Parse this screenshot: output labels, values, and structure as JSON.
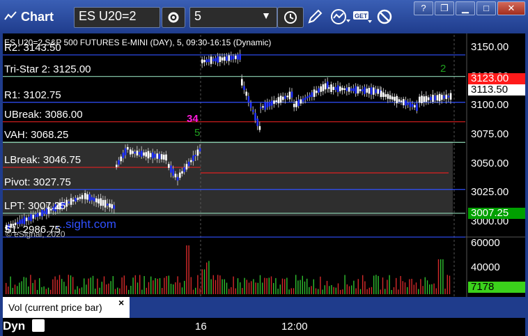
{
  "window": {
    "title": "Chart",
    "symbol": "ES U20=2",
    "interval": "5",
    "controls": [
      "help-icon",
      "restore-icon",
      "minimize-icon",
      "maximize-icon",
      "close-icon"
    ]
  },
  "chart": {
    "header": "ES U20=2 S&P 500 FUTURES E-MINI (DAY), 5, 09:30-16:15 (Dynamic)",
    "copyright": "© eSignal, 2020",
    "watermark": "...sight.com",
    "levels": [
      {
        "label": "R2: 3143.50",
        "value": 3143.5,
        "color": "#3050ff"
      },
      {
        "label": "Tri-Star 2: 3125.00",
        "value": 3125.0,
        "color": "#8fd7b5"
      },
      {
        "label": "R1: 3102.75",
        "value": 3102.75,
        "color": "#3050ff"
      },
      {
        "label": "UBreak: 3086.00",
        "value": 3086.0,
        "color": "#e02020"
      },
      {
        "label": "VAH: 3068.25",
        "value": 3068.25,
        "color": "#8fd7b5"
      },
      {
        "label": "LBreak: 3046.75",
        "value": 3046.75,
        "color": "#e02020"
      },
      {
        "label": "Pivot: 3027.75",
        "value": 3027.75,
        "color": "#3050ff"
      },
      {
        "label": "LPT: 3007.25",
        "value": 3007.25,
        "color": "#8fd7b5"
      },
      {
        "label": "S1: 2986.75",
        "value": 2986.75,
        "color": "#3050ff"
      }
    ],
    "price_ticks": [
      "3150.00",
      "3125.00",
      "3100.00",
      "3075.00",
      "3050.00",
      "3025.00",
      "3000.00"
    ],
    "price_flags": [
      {
        "text": "3123.00",
        "bg": "#ff1a1a",
        "color": "#ffffff"
      },
      {
        "text": "3113.50",
        "bg": "#ffffff",
        "color": "#000000"
      },
      {
        "text": "3007.25",
        "bg": "#00a000",
        "color": "#ffffff"
      }
    ],
    "markers": {
      "green_two": "2",
      "magenta_nums": "34",
      "green_five": "5",
      "green_bottom": "5"
    },
    "volume": {
      "label": "Vol (current price bar)",
      "ticks": [
        "60000",
        "40000"
      ],
      "last": "7178",
      "close_icon": "×"
    },
    "time_axis": [
      "16",
      "12:00"
    ],
    "dyn_label": "Dyn"
  }
}
